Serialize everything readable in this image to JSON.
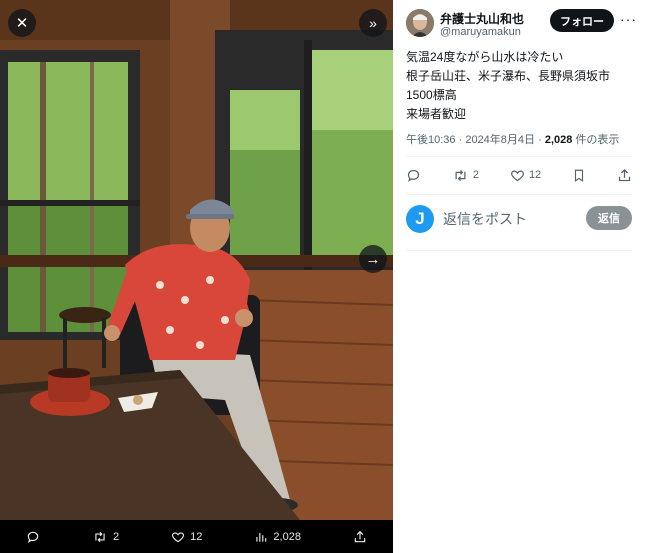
{
  "post": {
    "display_name": "弁護士丸山和也",
    "handle": "@maruyamakun",
    "follow_label": "フォロー",
    "more_label": "···",
    "text_lines": [
      "気温24度ながら山水は冷たい",
      "根子岳山荘、米子瀑布、長野県須坂市",
      "1500標高",
      "来場者歓迎"
    ],
    "time": "午後10:36",
    "date": "2024年8月4日",
    "views_count": "2,028",
    "views_label": "件の表示",
    "retweets": "2",
    "likes": "12"
  },
  "media_bar": {
    "retweets": "2",
    "likes": "12",
    "views": "2,028"
  },
  "reply": {
    "avatar_letter": "J",
    "placeholder": "返信をポスト",
    "button_label": "返信"
  },
  "icons": {
    "close": "✕",
    "expand": "»",
    "next": "→"
  }
}
